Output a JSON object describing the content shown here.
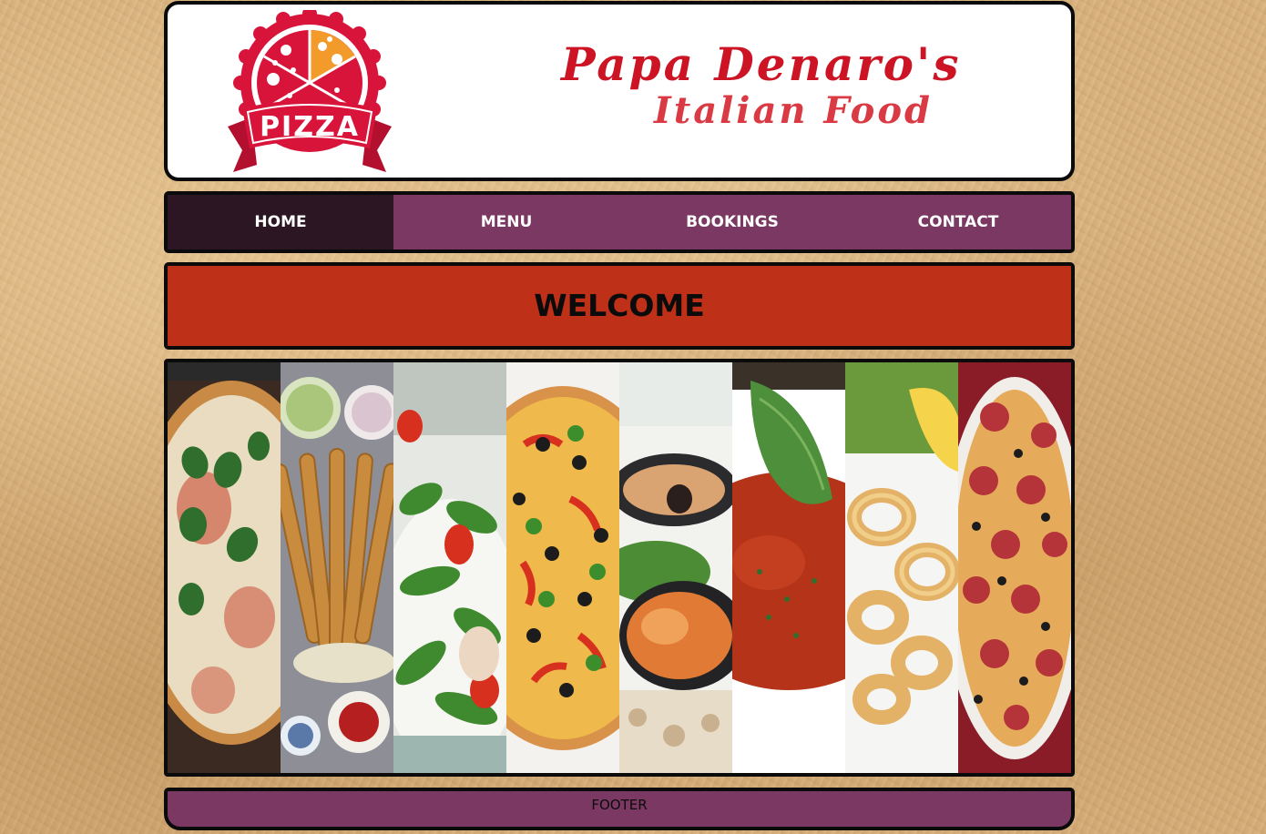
{
  "header": {
    "logo_text": "PIZZA",
    "brand_line1": "Papa Denaro's",
    "brand_line2": "Italian Food"
  },
  "nav": {
    "items": [
      {
        "label": "HOME",
        "active": true
      },
      {
        "label": "MENU",
        "active": false
      },
      {
        "label": "BOOKINGS",
        "active": false
      },
      {
        "label": "CONTACT",
        "active": false
      }
    ]
  },
  "welcome": {
    "title": "WELCOME"
  },
  "gallery": {
    "images": [
      {
        "icon": "margherita-pizza-image"
      },
      {
        "icon": "fried-churros-image"
      },
      {
        "icon": "green-salad-image"
      },
      {
        "icon": "vegetable-pizza-image"
      },
      {
        "icon": "mussels-seafood-image"
      },
      {
        "icon": "tomato-soup-image"
      },
      {
        "icon": "fried-calamari-image"
      },
      {
        "icon": "pepperoni-pizza-image"
      }
    ]
  },
  "footer": {
    "label": "FOOTER"
  },
  "colors": {
    "nav_bg": "#7b3863",
    "nav_active_bg": "#2d1623",
    "welcome_bg": "#be3018",
    "brand_red": "#cc1424",
    "border": "#0b0b0b",
    "page_bg": "#d9b17a"
  }
}
